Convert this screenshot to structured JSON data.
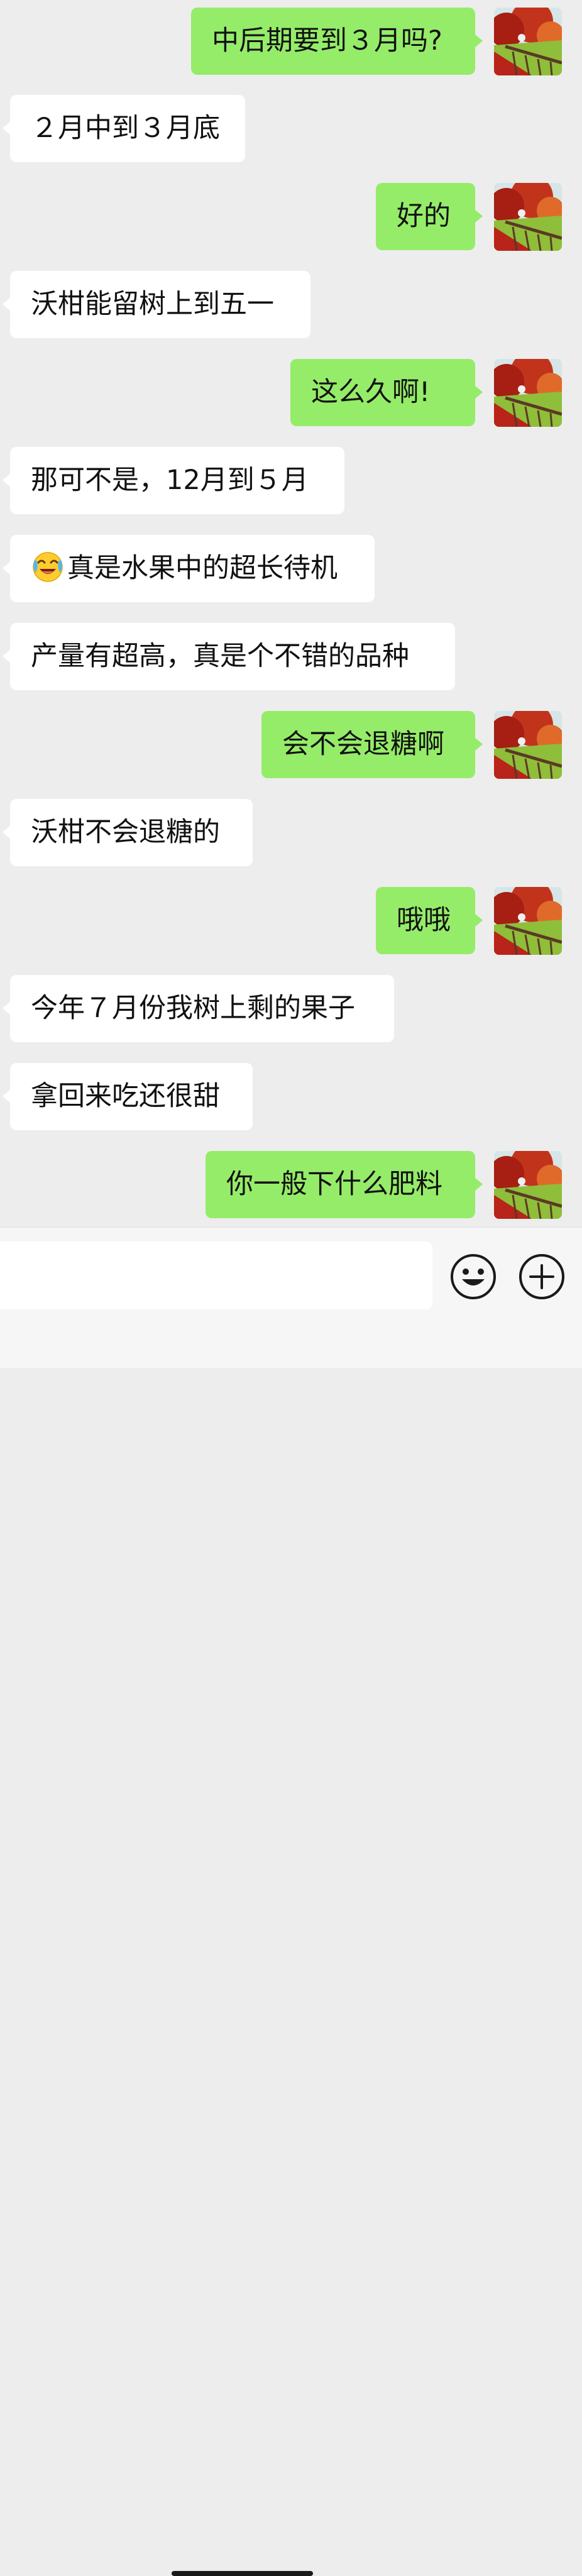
{
  "messages": [
    {
      "side": "sent",
      "text": "中后期要到３月吗?"
    },
    {
      "side": "recv",
      "text": "２月中到３月底"
    },
    {
      "side": "sent",
      "text": "好的"
    },
    {
      "side": "recv",
      "text": "沃柑能留树上到五一"
    },
    {
      "side": "sent",
      "text": "这么久啊!"
    },
    {
      "side": "recv",
      "text": "那可不是，12月到５月"
    },
    {
      "side": "recv",
      "text": "真是水果中的超长待机",
      "emoji": "laughing-crying-emoji"
    },
    {
      "side": "recv",
      "text": "产量有超高，真是个不错的品种"
    },
    {
      "side": "sent",
      "text": "会不会退糖啊"
    },
    {
      "side": "recv",
      "text": "沃柑不会退糖的"
    },
    {
      "side": "sent",
      "text": "哦哦"
    },
    {
      "side": "recv",
      "text": "今年７月份我树上剩的果子"
    },
    {
      "side": "recv",
      "text": "拿回来吃还很甜"
    },
    {
      "side": "sent",
      "text": "你一般下什么肥料"
    }
  ],
  "composer": {
    "input_value": "",
    "emoji_icon": "smiley-face-icon",
    "more_icon": "plus-circle-icon"
  },
  "colors": {
    "background": "#ededed",
    "sent_bubble": "#95ec69",
    "received_bubble": "#ffffff"
  }
}
